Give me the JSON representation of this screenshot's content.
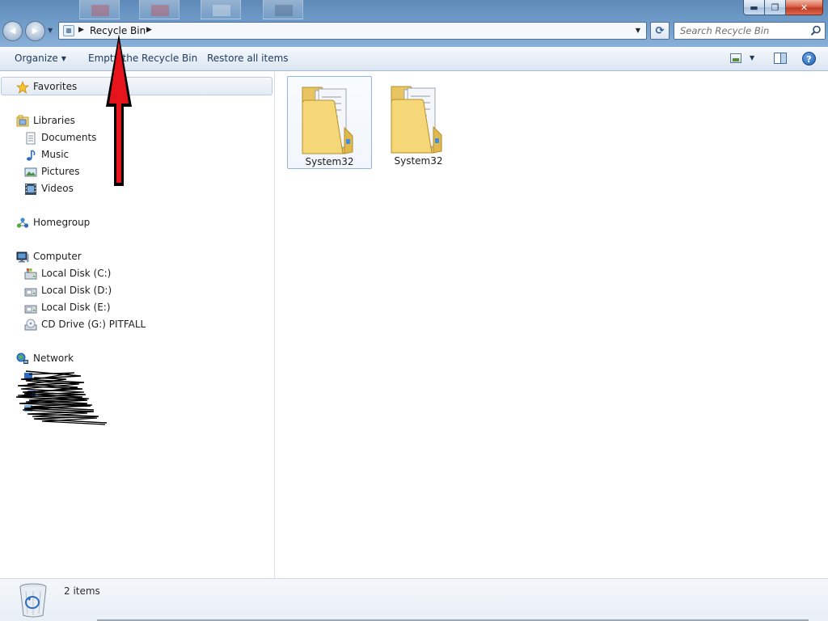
{
  "window": {
    "controls": {
      "minimize": "▬",
      "maximize": "❐",
      "close": "✕"
    }
  },
  "navigation": {
    "back_glyph": "◀",
    "forward_glyph": "▶",
    "recent_glyph": "▼"
  },
  "address_bar": {
    "breadcrumb": "Recycle Bin",
    "separator_glyph": "▶",
    "dropdown_glyph": "▼",
    "refresh_glyph": "⟳"
  },
  "search": {
    "placeholder": "Search Recycle Bin"
  },
  "command_bar": {
    "organize": "Organize",
    "caret": "▼",
    "empty_recycle_bin": "Empty the Recycle Bin",
    "restore_all_items": "Restore all items",
    "help": "?"
  },
  "nav_pane": {
    "favorites": "Favorites",
    "libraries": "Libraries",
    "library_items": [
      "Documents",
      "Music",
      "Pictures",
      "Videos"
    ],
    "homegroup": "Homegroup",
    "computer": "Computer",
    "drives": [
      "Local Disk (C:)",
      "Local Disk (D:)",
      "Local Disk (E:)",
      "CD Drive (G:) PITFALL"
    ],
    "network": "Network"
  },
  "files": [
    {
      "name": "System32",
      "type": "folder",
      "selected": true
    },
    {
      "name": "System32",
      "type": "folder",
      "selected": false
    }
  ],
  "details": {
    "item_count": "2 items"
  },
  "annotation": {
    "arrow_color": "#e8141c",
    "points_to": "address bar breadcrumb"
  },
  "colors": {
    "frame": "#6f9bc8",
    "command_text": "#1e395b",
    "selection_border": "#8fb7dc"
  }
}
